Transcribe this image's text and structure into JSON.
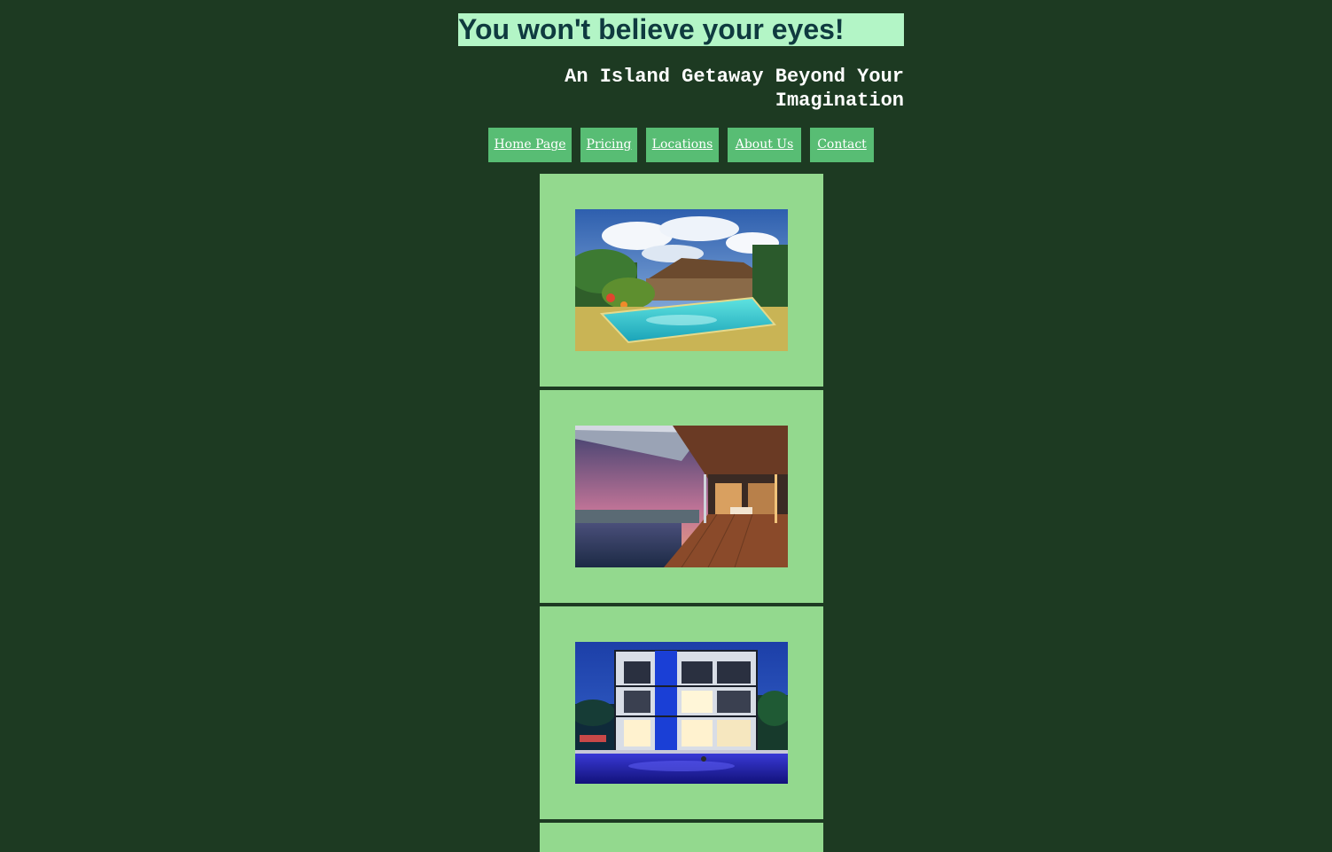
{
  "header": {
    "headline": "You won't believe your eyes!",
    "subheadline": "An Island Getaway Beyond Your Imagination"
  },
  "nav": {
    "items": [
      {
        "label": "Home Page"
      },
      {
        "label": "Pricing"
      },
      {
        "label": "Locations"
      },
      {
        "label": "About Us"
      },
      {
        "label": "Contact"
      }
    ]
  },
  "gallery": {
    "photos": [
      {
        "icon": "resort-pool-photo"
      },
      {
        "icon": "sunset-terrace-photo"
      },
      {
        "icon": "night-villa-photo"
      }
    ]
  },
  "colors": {
    "background": "#1d3a22",
    "headline_bg": "#b3f5c6",
    "nav_bg": "#58bd74",
    "card_bg": "#93d98e"
  }
}
